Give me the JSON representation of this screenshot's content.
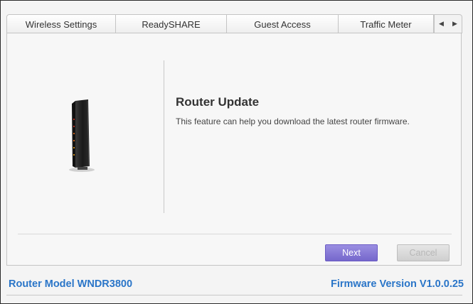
{
  "tabs": [
    {
      "label": "Wireless Settings"
    },
    {
      "label": "ReadySHARE"
    },
    {
      "label": "Guest Access"
    },
    {
      "label": "Traffic Meter"
    }
  ],
  "tab_nav": {
    "prev": "◀",
    "next": "▶"
  },
  "feature": {
    "title": "Router Update",
    "description": "This feature can help you download the latest router firmware."
  },
  "buttons": {
    "next": "Next",
    "cancel": "Cancel"
  },
  "footer": {
    "model": "Router Model WNDR3800",
    "firmware": "Firmware Version V1.0.0.25"
  },
  "colors": {
    "accent": "#2a75c8",
    "next_button": "#7f72d4"
  },
  "icons": {
    "router": "router-device-image"
  }
}
